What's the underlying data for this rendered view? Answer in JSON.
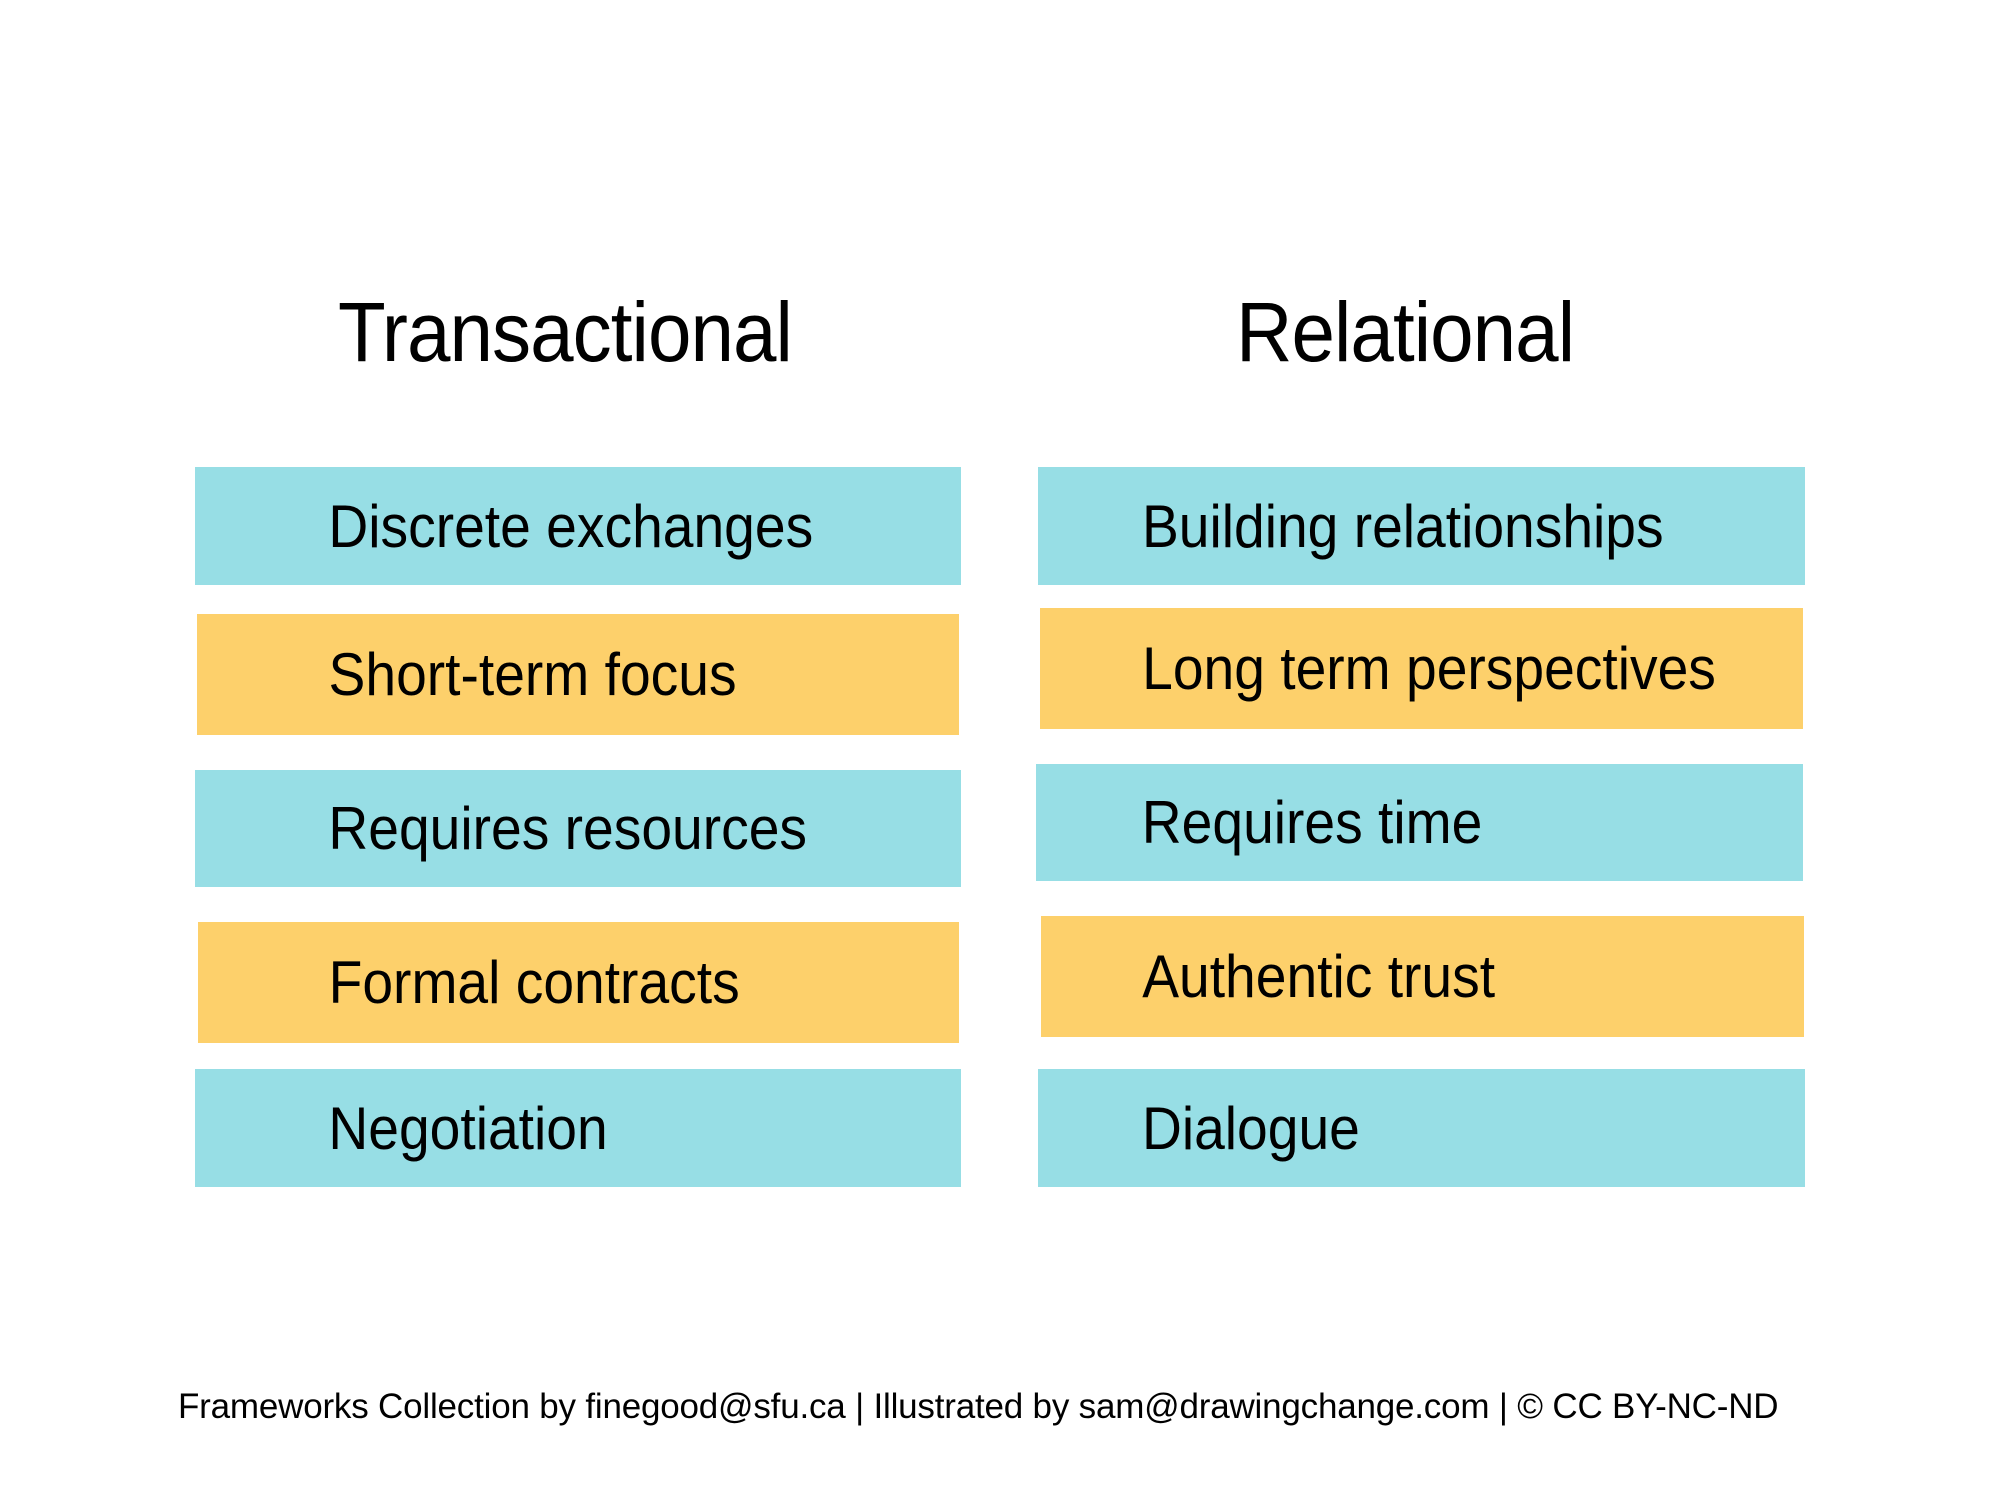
{
  "colors": {
    "cyan": "#97DEE5",
    "yellow": "#FDD06B",
    "text": "#000000",
    "background": "#FFFFFF"
  },
  "columns": [
    {
      "title": "Transactional",
      "items": [
        {
          "label": "Discrete exchanges",
          "color": "cyan"
        },
        {
          "label": "Short-term focus",
          "color": "yellow"
        },
        {
          "label": "Requires resources",
          "color": "cyan"
        },
        {
          "label": "Formal contracts",
          "color": "yellow"
        },
        {
          "label": "Negotiation",
          "color": "cyan"
        }
      ]
    },
    {
      "title": "Relational",
      "items": [
        {
          "label": "Building relationships",
          "color": "cyan"
        },
        {
          "label": "Long term perspectives",
          "color": "yellow"
        },
        {
          "label": "Requires time",
          "color": "cyan"
        },
        {
          "label": "Authentic trust",
          "color": "yellow"
        },
        {
          "label": "Dialogue",
          "color": "cyan"
        }
      ]
    }
  ],
  "footer": {
    "credit": "Frameworks Collection by finegood@sfu.ca | Illustrated by sam@drawingchange.com | © CC BY-NC-ND"
  }
}
